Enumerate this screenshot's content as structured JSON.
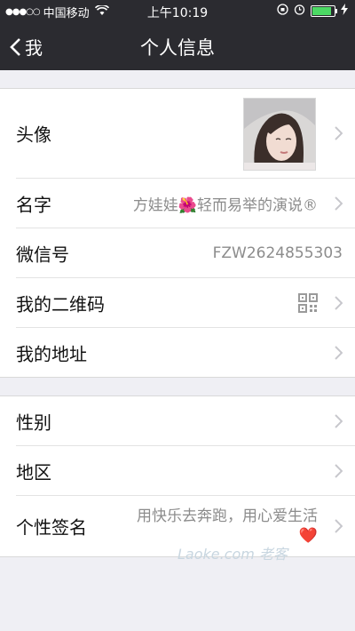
{
  "status_bar": {
    "signal_dots": "●●●○○",
    "carrier": "中国移动",
    "time": "上午10:19",
    "colors": {
      "battery": "#4cd964"
    }
  },
  "nav": {
    "back_label": "我",
    "title": "个人信息"
  },
  "profile": {
    "avatar_label": "头像",
    "name_label": "名字",
    "name_value": "方娃娃🌺轻而易举的演说®",
    "wechat_id_label": "微信号",
    "wechat_id_value": "FZW2624855303",
    "qr_label": "我的二维码",
    "address_label": "我的地址"
  },
  "details": {
    "gender_label": "性别",
    "region_label": "地区",
    "signature_label": "个性签名",
    "signature_value": "用快乐去奔跑，用心爱生活❤️"
  },
  "watermark": "Laoke.com 老客"
}
